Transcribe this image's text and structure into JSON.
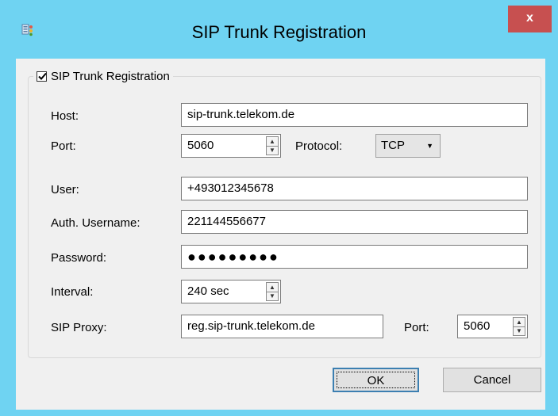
{
  "window": {
    "title": "SIP Trunk Registration",
    "close_label": "x"
  },
  "group": {
    "checkbox_label": "SIP Trunk Registration",
    "checked": true
  },
  "fields": {
    "host_label": "Host:",
    "host_value": "sip-trunk.telekom.de",
    "port_label": "Port:",
    "port_value": "5060",
    "protocol_label": "Protocol:",
    "protocol_value": "TCP",
    "user_label": "User:",
    "user_value": "+493012345678",
    "auth_label": "Auth. Username:",
    "auth_value": "221144556677",
    "password_label": "Password:",
    "password_value": "●●●●●●●●●",
    "interval_label": "Interval:",
    "interval_value": "240 sec",
    "proxy_label": "SIP Proxy:",
    "proxy_value": "reg.sip-trunk.telekom.de",
    "proxy_port_label": "Port:",
    "proxy_port_value": "5060"
  },
  "buttons": {
    "ok_label": "OK",
    "cancel_label": "Cancel"
  },
  "colors": {
    "title_bar": "#6fd3f2",
    "close_button": "#c75050",
    "dialog_bg": "#f0f0f0"
  }
}
